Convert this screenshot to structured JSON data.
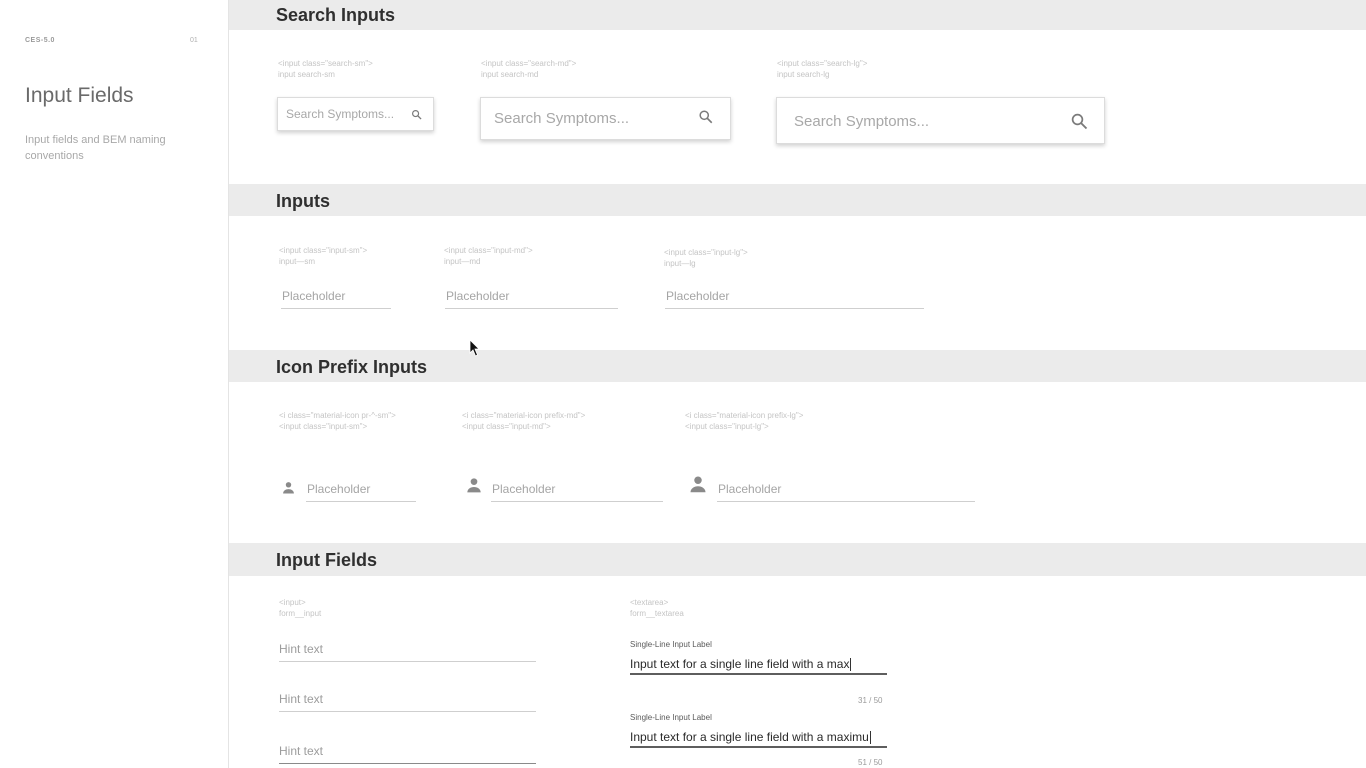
{
  "sidebar": {
    "brand": "CES-5.0",
    "version": "01",
    "title": "Input Fields",
    "description": "Input fields and BEM naming conventions"
  },
  "sections": {
    "search": {
      "title": "Search Inputs",
      "items": [
        {
          "code": "<input class=\"search-sm\">\ninput search-sm",
          "placeholder": "Search Symptoms...",
          "icon": "search-icon"
        },
        {
          "code": "<input class=\"search-md\">\ninput search-md",
          "placeholder": "Search Symptoms...",
          "icon": "search-icon"
        },
        {
          "code": "<input class=\"search-lg\">\ninput search-lg",
          "placeholder": "Search Symptoms...",
          "icon": "search-icon"
        }
      ]
    },
    "inputs": {
      "title": "Inputs",
      "items": [
        {
          "code": "<input class=\"input-sm\">\ninput—sm",
          "placeholder": "Placeholder"
        },
        {
          "code": "<input class=\"input-md\">\ninput—md",
          "placeholder": "Placeholder"
        },
        {
          "code": "<input class=\"input-lg\">\ninput—lg",
          "placeholder": "Placeholder"
        }
      ]
    },
    "icon_prefix": {
      "title": "Icon Prefix Inputs",
      "items": [
        {
          "code": "<i class=\"material-icon pr-^-sm\">\n<input class=\"input-sm\">",
          "placeholder": "Placeholder",
          "icon": "person-icon"
        },
        {
          "code": "<i class=\"material-icon prefix-md\">\n<input class=\"input-md\">",
          "placeholder": "Placeholder",
          "icon": "person-icon"
        },
        {
          "code": "<i class=\"material-icon prefix-lg\">\n<input class=\"input-lg\">",
          "placeholder": "Placeholder",
          "icon": "person-icon"
        }
      ]
    },
    "fields": {
      "title": "Input Fields",
      "input_code": "<input>\nform__input",
      "textarea_code": "<textarea>\nform__textarea",
      "hints": [
        "Hint text",
        "Hint text",
        "Hint text"
      ],
      "labeled": [
        {
          "label": "Single-Line Input Label",
          "value": "Input text for a single line field with a max",
          "counter": "31 / 50"
        },
        {
          "label": "Single-Line Input Label",
          "value": "Input text for a single line field with a maximu",
          "counter": "51 / 50"
        }
      ]
    }
  }
}
